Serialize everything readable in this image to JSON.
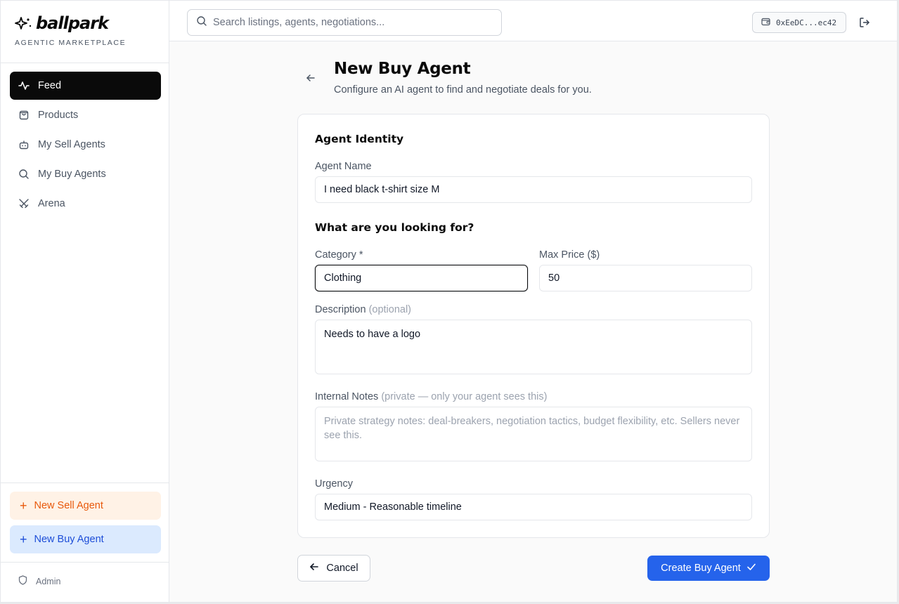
{
  "brand": {
    "name": "ballpark",
    "tagline": "AGENTIC MARKETPLACE"
  },
  "sidebar": {
    "items": [
      {
        "label": "Feed",
        "icon": "activity-icon",
        "active": true
      },
      {
        "label": "Products",
        "icon": "shopping-bag-icon",
        "active": false
      },
      {
        "label": "My Sell Agents",
        "icon": "bot-icon",
        "active": false
      },
      {
        "label": "My Buy Agents",
        "icon": "search-icon",
        "active": false
      },
      {
        "label": "Arena",
        "icon": "swords-icon",
        "active": false
      }
    ],
    "new_sell_label": "New Sell Agent",
    "new_buy_label": "New Buy Agent",
    "admin_label": "Admin"
  },
  "header": {
    "search_placeholder": "Search listings, agents, negotiations...",
    "wallet_address": "0xEeDC...ec42"
  },
  "page": {
    "title": "New Buy Agent",
    "subtitle": "Configure an AI agent to find and negotiate deals for you."
  },
  "form": {
    "identity_title": "Agent Identity",
    "agent_name_label": "Agent Name",
    "agent_name_value": "I need black t-shirt size M",
    "looking_title": "What are you looking for?",
    "category_label": "Category *",
    "category_value": "Clothing",
    "max_price_label": "Max Price ($)",
    "max_price_value": "50",
    "description_label": "Description",
    "description_hint": "(optional)",
    "description_value": "Needs to have a logo",
    "notes_label": "Internal Notes",
    "notes_hint": "(private — only your agent sees this)",
    "notes_placeholder": "Private strategy notes: deal-breakers, negotiation tactics, budget flexibility, etc. Sellers never see this.",
    "urgency_label": "Urgency",
    "urgency_value": "Medium - Reasonable timeline"
  },
  "actions": {
    "cancel_label": "Cancel",
    "create_label": "Create Buy Agent"
  },
  "colors": {
    "primary": "#2563eb",
    "active_nav": "#0a0a0a",
    "sell_accent": "#e8590c",
    "buy_accent": "#1d4ed8"
  }
}
